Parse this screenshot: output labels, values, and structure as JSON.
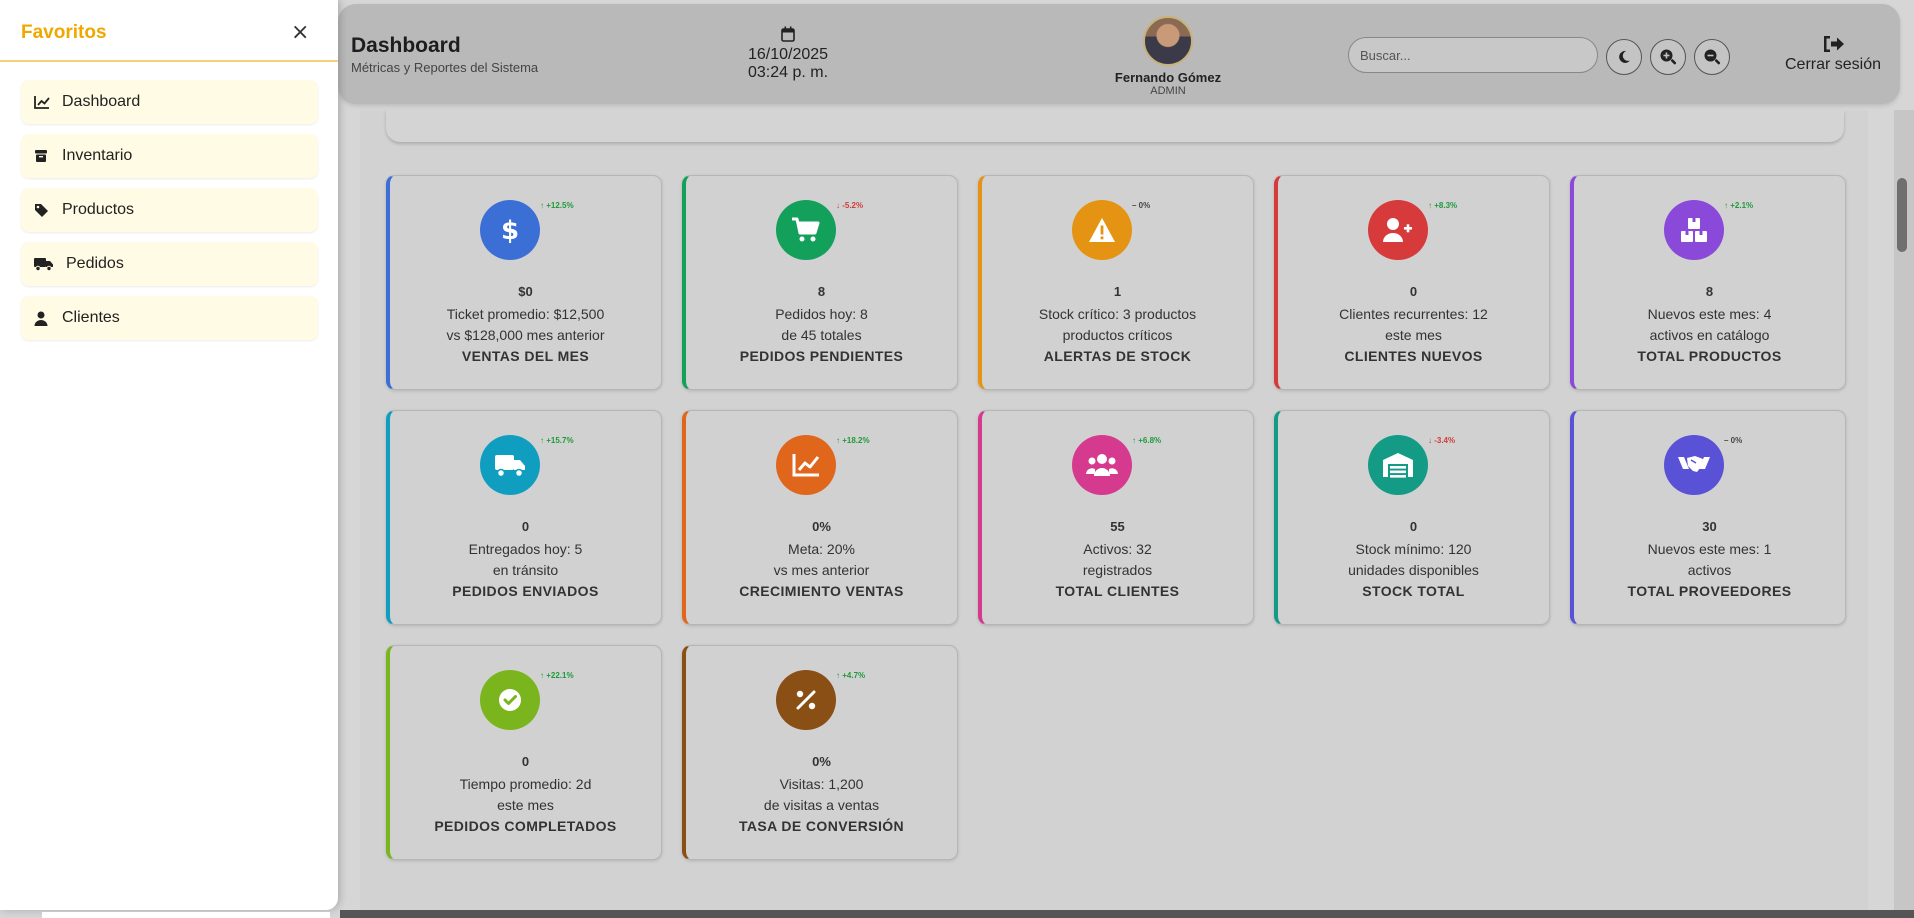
{
  "favorites": {
    "title": "Favoritos",
    "close": "×",
    "items": [
      {
        "label": "Dashboard",
        "icon": "chart-line-icon"
      },
      {
        "label": "Inventario",
        "icon": "box-icon"
      },
      {
        "label": "Productos",
        "icon": "tag-icon"
      },
      {
        "label": "Pedidos",
        "icon": "truck-icon"
      },
      {
        "label": "Clientes",
        "icon": "user-icon"
      }
    ]
  },
  "header": {
    "title": "Dashboard",
    "subtitle": "Métricas y Reportes del Sistema",
    "date": "16/10/2025",
    "time": "03:24 p. m.",
    "user_name": "Fernando Gómez",
    "user_role": "ADMIN",
    "search_placeholder": "Buscar...",
    "logout_label": "Cerrar sesión"
  },
  "cards": [
    {
      "value": "$0",
      "line1": "Ticket promedio: $12,500",
      "line2": "vs $128,000 mes anterior",
      "title": "VENTAS DEL MES",
      "trend": "↑ +12.5%",
      "trend_dir": "up",
      "color": "#3b6fd6",
      "icon": "dollar-icon"
    },
    {
      "value": "8",
      "line1": "Pedidos hoy: 8",
      "line2": "de 45 totales",
      "title": "PEDIDOS PENDIENTES",
      "trend": "↓ -5.2%",
      "trend_dir": "down",
      "color": "#12a05a",
      "icon": "cart-icon"
    },
    {
      "value": "1",
      "line1": "Stock crítico: 3 productos",
      "line2": "productos críticos",
      "title": "ALERTAS DE STOCK",
      "trend": "– 0%",
      "trend_dir": "flat",
      "color": "#e59312",
      "icon": "warning-icon"
    },
    {
      "value": "0",
      "line1": "Clientes recurrentes: 12",
      "line2": "este mes",
      "title": "CLIENTES NUEVOS",
      "trend": "↑ +8.3%",
      "trend_dir": "up",
      "color": "#d63a3a",
      "icon": "user-plus-icon"
    },
    {
      "value": "8",
      "line1": "Nuevos este mes: 4",
      "line2": "activos en catálogo",
      "title": "TOTAL PRODUCTOS",
      "trend": "↑ +2.1%",
      "trend_dir": "up",
      "color": "#8a49d8",
      "icon": "boxes-icon"
    },
    {
      "value": "0",
      "line1": "Entregados hoy: 5",
      "line2": "en tránsito",
      "title": "PEDIDOS ENVIADOS",
      "trend": "↑ +15.7%",
      "trend_dir": "up",
      "color": "#0f9ec0",
      "icon": "truck-fast-icon"
    },
    {
      "value": "0%",
      "line1": "Meta: 20%",
      "line2": "vs mes anterior",
      "title": "CRECIMIENTO VENTAS",
      "trend": "↑ +18.2%",
      "trend_dir": "up",
      "color": "#e0661c",
      "icon": "chart-line-icon"
    },
    {
      "value": "55",
      "line1": "Activos: 32",
      "line2": "registrados",
      "title": "TOTAL CLIENTES",
      "trend": "↑ +6.8%",
      "trend_dir": "up",
      "color": "#d63a8e",
      "icon": "users-icon"
    },
    {
      "value": "0",
      "line1": "Stock mínimo: 120",
      "line2": "unidades disponibles",
      "title": "STOCK TOTAL",
      "trend": "↓ -3.4%",
      "trend_dir": "down",
      "color": "#139b86",
      "icon": "warehouse-icon"
    },
    {
      "value": "30",
      "line1": "Nuevos este mes: 1",
      "line2": "activos",
      "title": "TOTAL PROVEEDORES",
      "trend": "– 0%",
      "trend_dir": "flat",
      "color": "#5a52d6",
      "icon": "handshake-icon"
    },
    {
      "value": "0",
      "line1": "Tiempo promedio: 2d",
      "line2": "este mes",
      "title": "PEDIDOS COMPLETADOS",
      "trend": "↑ +22.1%",
      "trend_dir": "up",
      "color": "#7bb51e",
      "icon": "check-circle-icon"
    },
    {
      "value": "0%",
      "line1": "Visitas: 1,200",
      "line2": "de visitas a ventas",
      "title": "TASA DE CONVERSIÓN",
      "trend": "↑ +4.7%",
      "trend_dir": "up",
      "color": "#8a4f14",
      "icon": "percent-icon"
    }
  ]
}
